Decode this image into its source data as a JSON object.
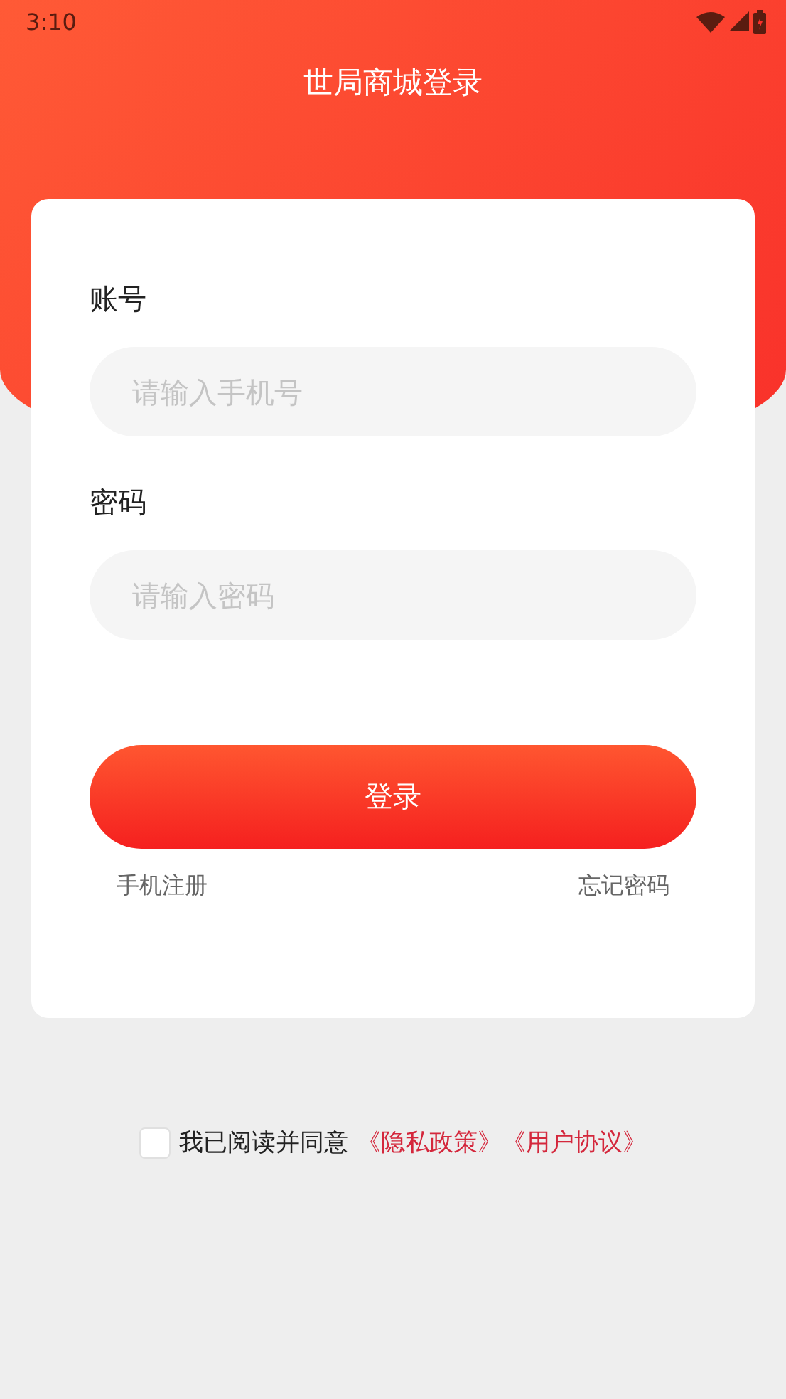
{
  "status_bar": {
    "time": "3:10"
  },
  "header": {
    "title": "世局商城登录"
  },
  "form": {
    "fields": [
      {
        "label": "账号",
        "placeholder": "请输入手机号"
      },
      {
        "label": "密码",
        "placeholder": "请输入密码"
      }
    ],
    "submit": "登录",
    "links": [
      "手机注册",
      "忘记密码"
    ]
  },
  "agreement": {
    "checked": false,
    "text": "我已阅读并同意",
    "links": [
      "《隐私政策》",
      "《用户协议》"
    ]
  }
}
